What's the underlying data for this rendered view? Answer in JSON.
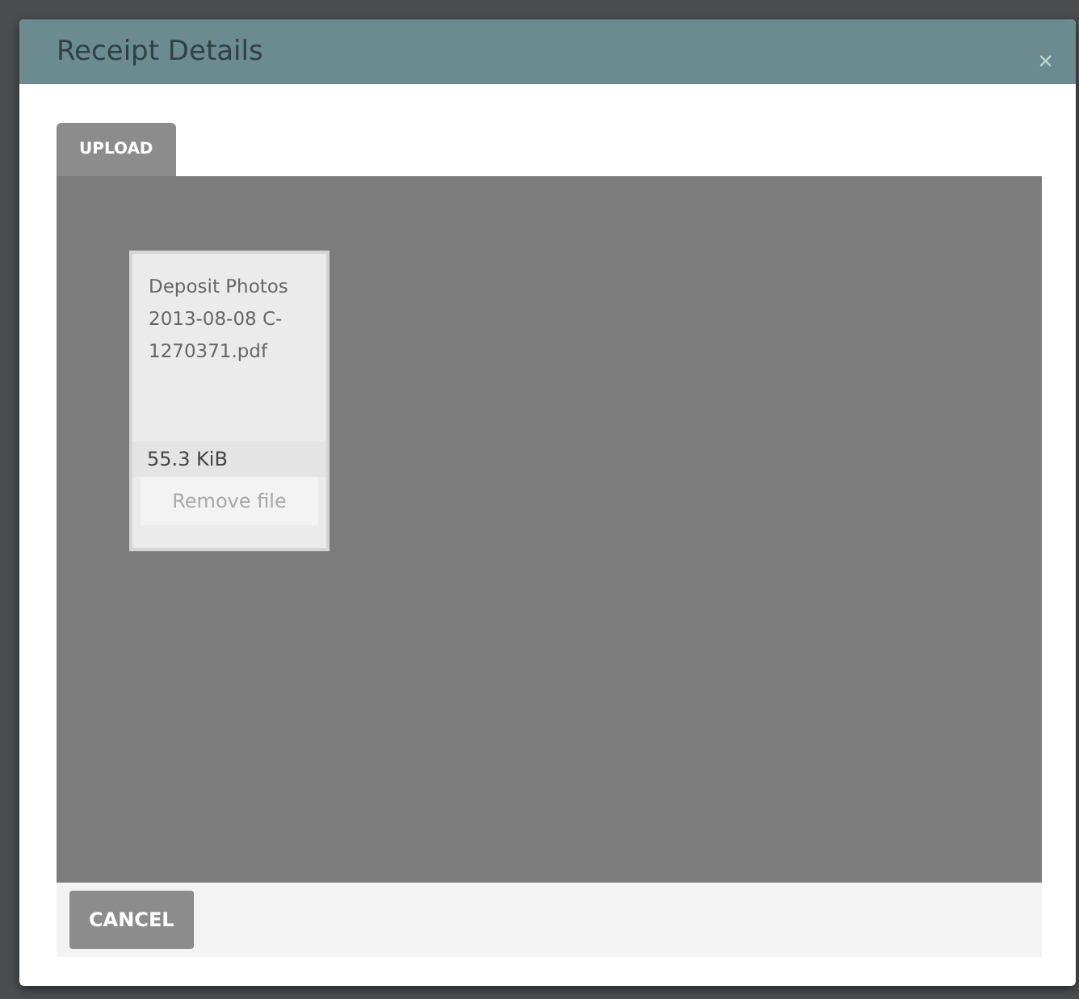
{
  "dialog": {
    "title": "Receipt Details",
    "close": "×"
  },
  "tabs": [
    {
      "label": "UPLOAD",
      "selected": true
    }
  ],
  "files": [
    {
      "name": "Deposit Photos 2013-08-08 C-1270371.pdf",
      "size": "55.3 KiB",
      "remove": "Remove file"
    }
  ],
  "buttons": [
    "CANCEL"
  ]
}
